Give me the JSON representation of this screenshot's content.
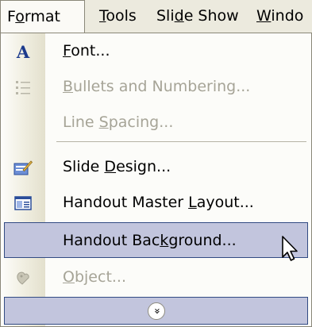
{
  "menubar": {
    "items": [
      {
        "label": "Format",
        "underline_index": 1,
        "active": true
      },
      {
        "label": "Tools",
        "underline_index": 0
      },
      {
        "label": "Slide Show",
        "underline_index": 3
      },
      {
        "label": "Windo",
        "underline_index": 0
      }
    ]
  },
  "menu": {
    "items": [
      {
        "label": "Font...",
        "underline_index": 0,
        "icon": "font-A-icon",
        "enabled": true
      },
      {
        "label": "Bullets and Numbering...",
        "underline_index": 0,
        "icon": "bullets-icon",
        "enabled": false
      },
      {
        "label": "Line Spacing...",
        "underline_index": 5,
        "icon": null,
        "enabled": false
      },
      {
        "label": "Slide Design...",
        "underline_index": 6,
        "icon": "slide-design-icon",
        "enabled": true
      },
      {
        "label": "Handout Master Layout...",
        "underline_index": 15,
        "icon": "master-layout-icon",
        "enabled": true
      },
      {
        "label": "Handout Background...",
        "underline_index": 11,
        "icon": null,
        "enabled": true,
        "selected": true
      },
      {
        "label": "Object...",
        "underline_index": 0,
        "icon": "object-icon",
        "enabled": false
      }
    ],
    "expand_icon": "chevron-double-down-icon",
    "expand_glyph": "»"
  },
  "colors": {
    "menubar_bg": "#eceade",
    "menu_bg": "#fcfcf9",
    "highlight_bg": "#c2c5dd",
    "highlight_border": "#324b83",
    "disabled_text": "#a6a497"
  }
}
